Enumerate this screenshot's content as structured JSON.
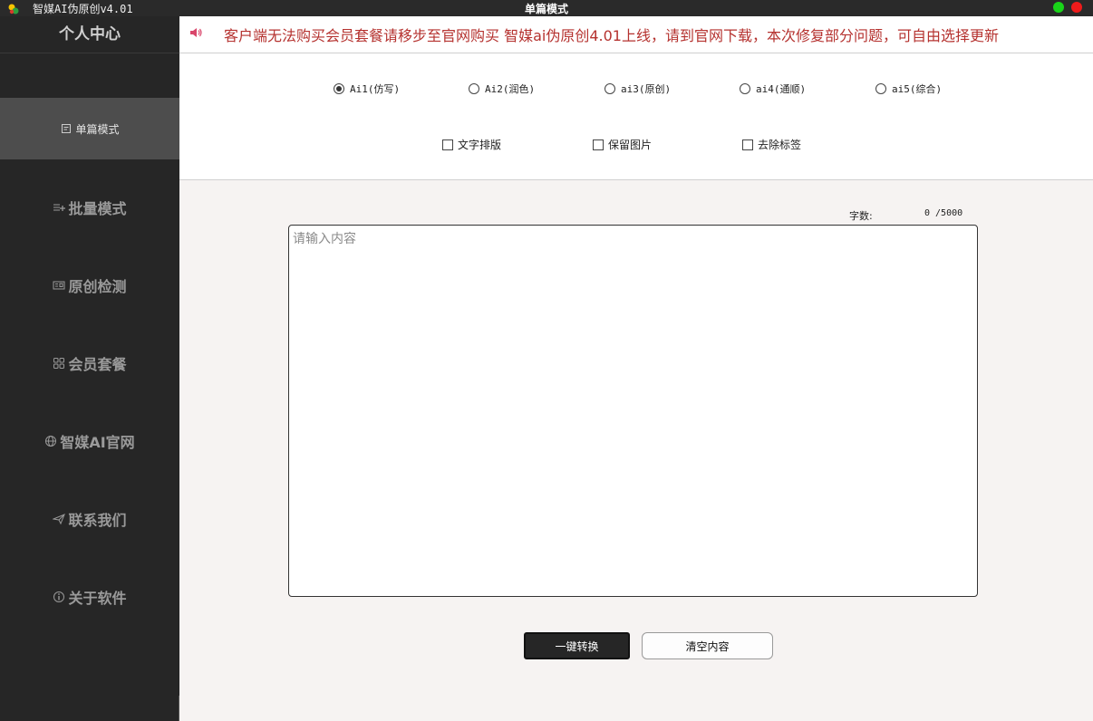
{
  "titlebar": {
    "app_name": "智媒AI伪原创v4.01",
    "window_title": "单篇模式"
  },
  "sidebar": {
    "profile": "个人中心",
    "items": [
      {
        "label": "单篇模式",
        "icon": "document-icon",
        "active": true
      },
      {
        "label": "批量模式",
        "icon": "list-add-icon",
        "active": false
      },
      {
        "label": "原创检测",
        "icon": "id-card-icon",
        "active": false
      },
      {
        "label": "会员套餐",
        "icon": "grid-icon",
        "active": false
      },
      {
        "label": "智媒AI官网",
        "icon": "globe-icon",
        "active": false
      },
      {
        "label": "联系我们",
        "icon": "paper-plane-icon",
        "active": false
      },
      {
        "label": "关于软件",
        "icon": "info-icon",
        "active": false
      }
    ]
  },
  "notice": {
    "text": "客户端无法购买会员套餐请移步至官网购买 智媒ai伪原创4.01上线，请到官网下载，本次修复部分问题，可自由选择更新"
  },
  "modes": {
    "selected": "Ai1(仿写)",
    "options": [
      "Ai1(仿写)",
      "Ai2(润色)",
      "ai3(原创)",
      "ai4(通顺)",
      "ai5(综合)"
    ]
  },
  "checks": {
    "options": [
      "文字排版",
      "保留图片",
      "去除标签"
    ]
  },
  "counter": {
    "label": "字数:",
    "value": "0 /5000"
  },
  "editor": {
    "placeholder": "请输入内容",
    "value": ""
  },
  "actions": {
    "convert": "一键转换",
    "clear": "清空内容"
  },
  "colors": {
    "notice_text": "#b5322f",
    "sidebar_bg": "#262626",
    "active_item_bg": "#4d4d4d",
    "window_green": "#19d419",
    "window_red": "#ee1b1b"
  }
}
